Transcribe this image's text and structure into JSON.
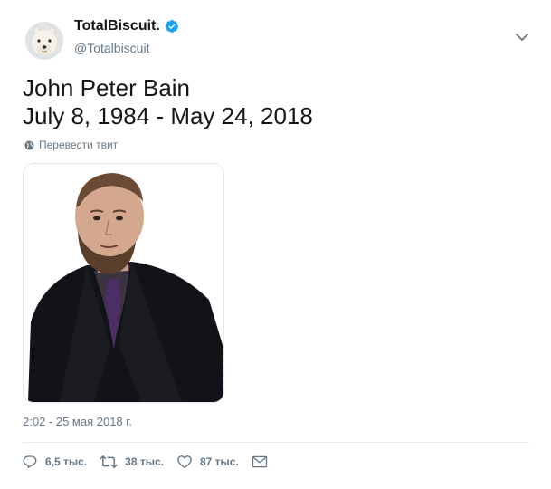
{
  "tweet": {
    "author": {
      "display_name": "TotalBiscuit.",
      "handle": "@Totalbiscuit",
      "verified": true
    },
    "text_lines": [
      "John Peter Bain",
      "July 8, 1984 - May 24, 2018"
    ],
    "translate_label": "Перевести твит",
    "timestamp": "2:02 - 25 мая 2018 г.",
    "stats": {
      "replies": "6,5 тыс.",
      "retweets": "38 тыс.",
      "likes": "87 тыс."
    }
  },
  "colors": {
    "text_primary": "#14171a",
    "text_secondary": "#657786",
    "verified": "#1da1f2",
    "divider": "#e6ecf0"
  },
  "icons": {
    "caret": "chevron-down-icon",
    "verified": "verified-badge-icon",
    "translate": "globe-icon",
    "reply": "reply-icon",
    "retweet": "retweet-icon",
    "like": "heart-icon",
    "message": "envelope-icon"
  }
}
